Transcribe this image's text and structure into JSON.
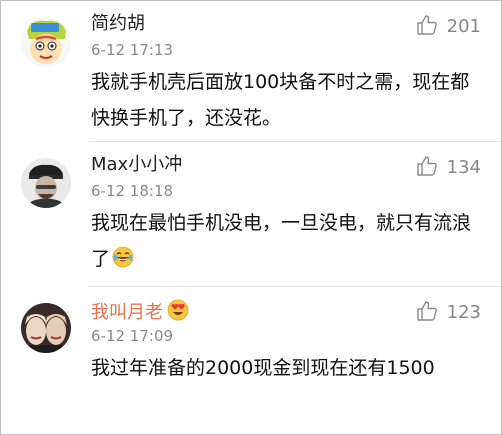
{
  "comments": [
    {
      "username": "简约胡",
      "time": "6-12 17:13",
      "likes": "201",
      "text": "我就手机壳后面放100块备不时之需，现在都快换手机了，还没花。",
      "avatar_icon": "cartoon-avatar-icon",
      "username_color": "#222222"
    },
    {
      "username": "Max小小冲",
      "time": "6-12 18:18",
      "likes": "134",
      "text": "我现在最怕手机没电，一旦没电，就只有流浪了",
      "trailing_emoji": "laughing-tears-emoji-icon",
      "avatar_icon": "photo-avatar-icon",
      "username_color": "#222222"
    },
    {
      "username": "我叫月老",
      "time": "6-12 17:09",
      "likes": "123",
      "text": "我过年准备的2000现金到现在还有1500",
      "badge_icon": "heart-eyes-emoji-icon",
      "avatar_icon": "photo-avatar-icon",
      "username_color": "#eb7350"
    }
  ],
  "icons": {
    "like": "thumbs-up-icon"
  }
}
